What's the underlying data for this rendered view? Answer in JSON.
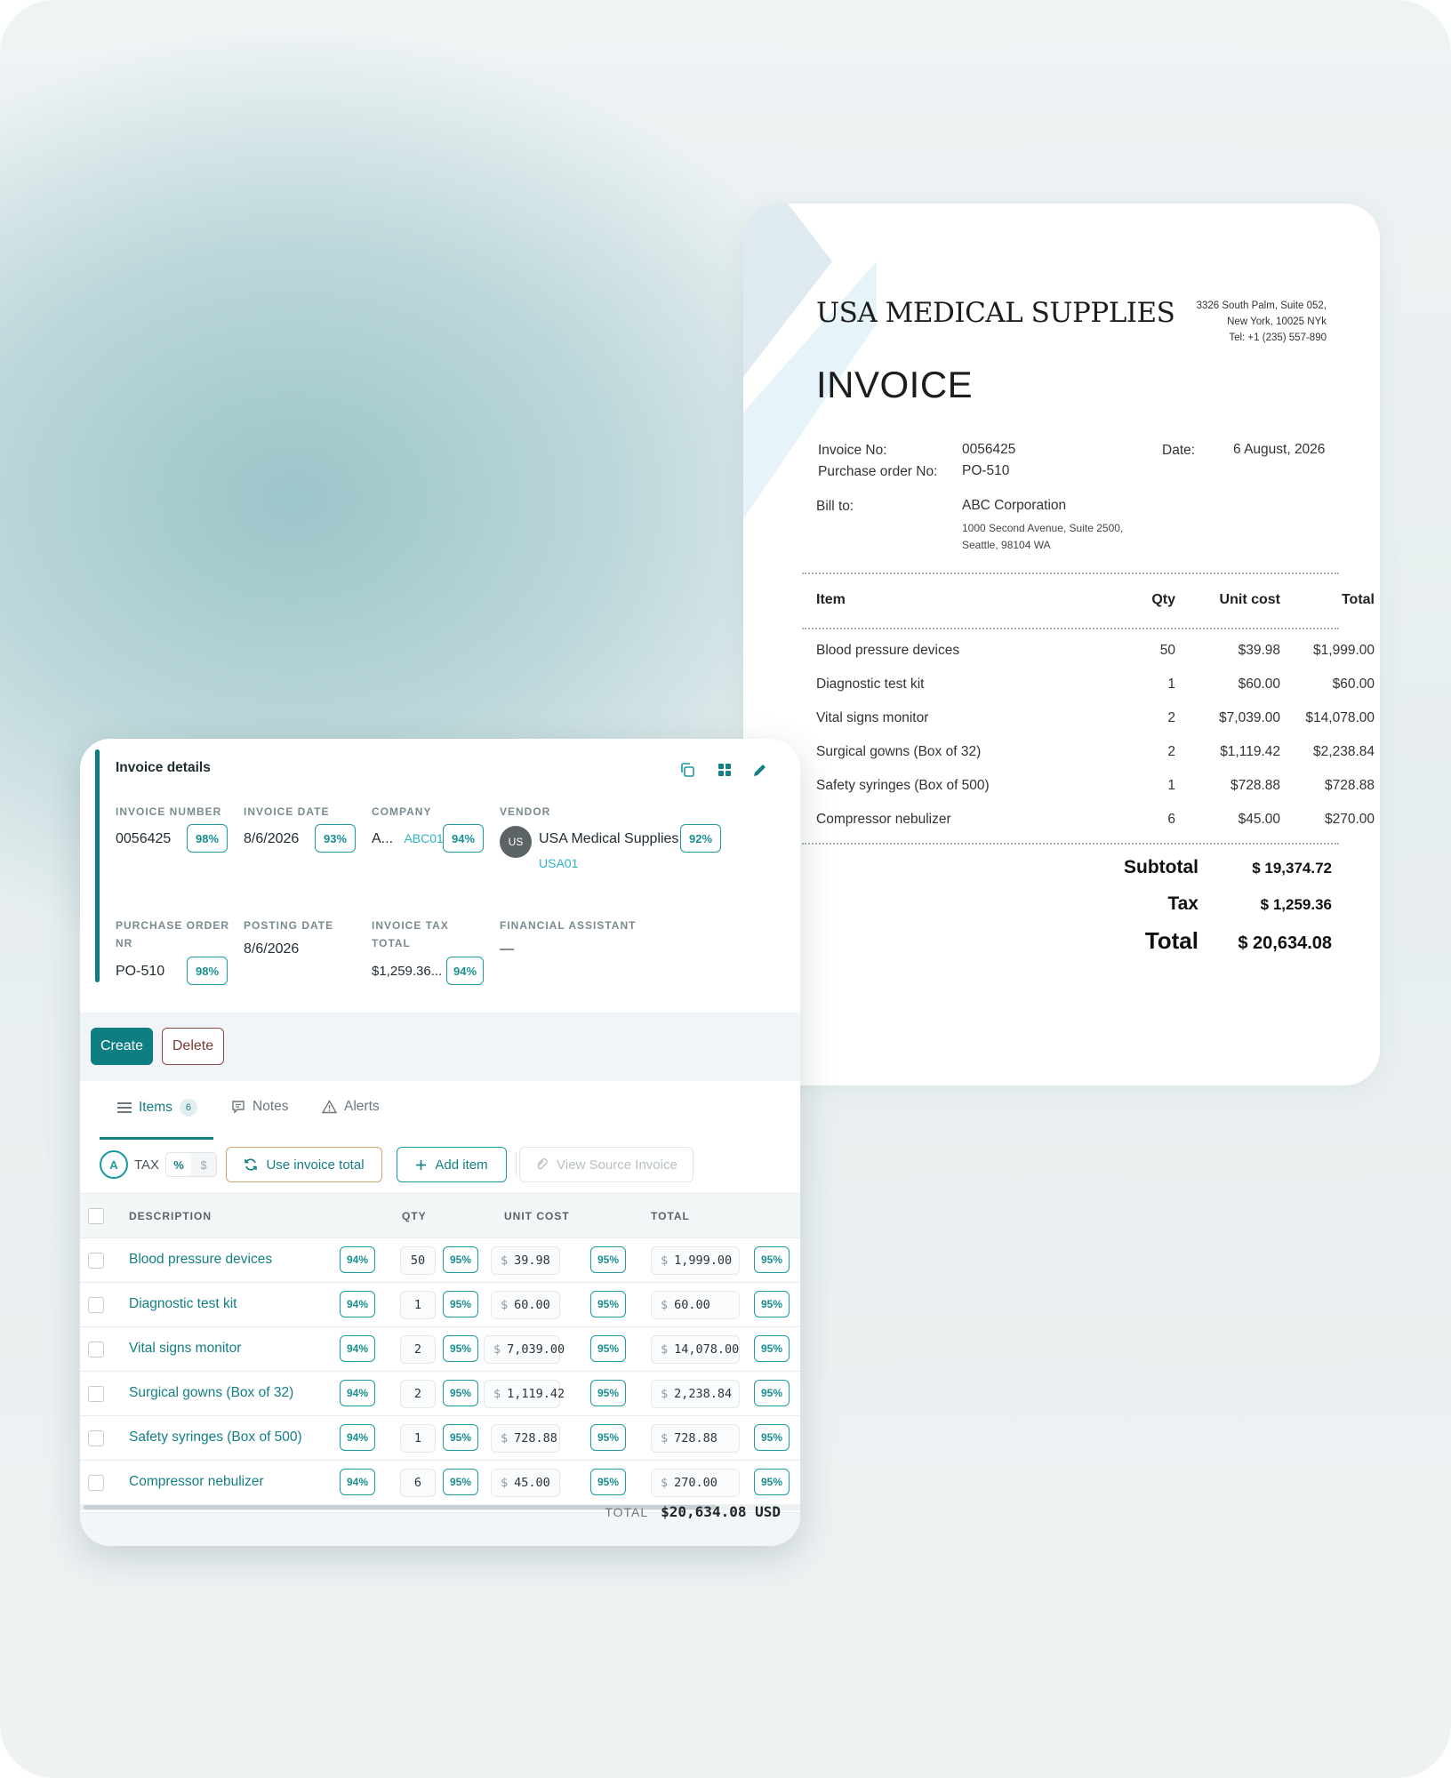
{
  "document": {
    "company": "USA MEDICAL SUPPLIES",
    "address": [
      "3326 South Palm, Suite 052,",
      "New York, 10025 NYk",
      "Tel: +1 (235) 557-890"
    ],
    "title": "INVOICE",
    "invoice_no_label": "Invoice No:",
    "invoice_no": "0056425",
    "po_label": "Purchase order No:",
    "po": "PO-510",
    "date_label": "Date:",
    "date": "6 August, 2026",
    "bill_to_label": "Bill to:",
    "bill_to_name": "ABC Corporation",
    "bill_to_address": [
      "1000 Second Avenue, Suite 2500,",
      "Seattle, 98104 WA"
    ],
    "headers": {
      "item": "Item",
      "qty": "Qty",
      "unit_cost": "Unit cost",
      "total": "Total"
    },
    "rows": [
      {
        "item": "Blood pressure devices",
        "qty": "50",
        "unit_cost": "$39.98",
        "total": "$1,999.00"
      },
      {
        "item": "Diagnostic test kit",
        "qty": "1",
        "unit_cost": "$60.00",
        "total": "$60.00"
      },
      {
        "item": "Vital signs monitor",
        "qty": "2",
        "unit_cost": "$7,039.00",
        "total": "$14,078.00"
      },
      {
        "item": "Surgical gowns (Box of 32)",
        "qty": "2",
        "unit_cost": "$1,119.42",
        "total": "$2,238.84"
      },
      {
        "item": "Safety syringes (Box of 500)",
        "qty": "1",
        "unit_cost": "$728.88",
        "total": "$728.88"
      },
      {
        "item": "Compressor nebulizer",
        "qty": "6",
        "unit_cost": "$45.00",
        "total": "$270.00"
      }
    ],
    "subtotal_label": "Subtotal",
    "subtotal": "$ 19,374.72",
    "tax_label": "Tax",
    "tax": "$ 1,259.36",
    "total_label": "Total",
    "total": "$ 20,634.08"
  },
  "panel": {
    "title": "Invoice details",
    "fields": {
      "invoice_number": {
        "label": "INVOICE NUMBER",
        "value": "0056425",
        "confidence": "98%"
      },
      "invoice_date": {
        "label": "INVOICE DATE",
        "value": "8/6/2026",
        "confidence": "93%"
      },
      "company": {
        "label": "COMPANY",
        "value": "A...",
        "code": "ABC01",
        "confidence": "94%"
      },
      "vendor": {
        "label": "VENDOR",
        "avatar": "US",
        "value": "USA Medical Supplies",
        "code": "USA01",
        "confidence": "92%"
      },
      "purchase_order": {
        "label_line1": "PURCHASE ORDER",
        "label_line2": "NR",
        "value": "PO-510",
        "confidence": "98%"
      },
      "posting_date": {
        "label": "POSTING DATE",
        "value": "8/6/2026"
      },
      "invoice_tax_total": {
        "label_line1": "INVOICE TAX",
        "label_line2": "TOTAL",
        "value": "$1,259.36...",
        "confidence": "94%"
      },
      "financial_assistant": {
        "label": "FINANCIAL ASSISTANT",
        "value": "—"
      }
    },
    "create_label": "Create",
    "delete_label": "Delete",
    "tabs": [
      {
        "label": "Items",
        "count": "6",
        "icon": "list-icon"
      },
      {
        "label": "Notes",
        "icon": "comment-icon"
      },
      {
        "label": "Alerts",
        "icon": "warning-icon"
      }
    ],
    "toolbar": {
      "auto_badge": "A",
      "tax_label": "TAX",
      "pct": "%",
      "dollar": "$",
      "use_invoice_total": "Use invoice total",
      "add_item": "Add item",
      "view_source": "View Source Invoice"
    },
    "grid_headers": {
      "description": "DESCRIPTION",
      "qty": "QTY",
      "unit_cost": "UNIT COST",
      "total": "TOTAL"
    },
    "currency_symbol": "$",
    "items": [
      {
        "description": "Blood pressure devices",
        "desc_conf": "94%",
        "qty": "50",
        "qty_conf": "95%",
        "unit_cost": "39.98",
        "unit_conf": "95%",
        "total": "1,999.00",
        "total_conf": "95%"
      },
      {
        "description": "Diagnostic test kit",
        "desc_conf": "94%",
        "qty": "1",
        "qty_conf": "95%",
        "unit_cost": "60.00",
        "unit_conf": "95%",
        "total": "60.00",
        "total_conf": "95%"
      },
      {
        "description": "Vital signs monitor",
        "desc_conf": "94%",
        "qty": "2",
        "qty_conf": "95%",
        "unit_cost": "7,039.00",
        "unit_conf": "95%",
        "total": "14,078.00",
        "total_conf": "95%"
      },
      {
        "description": "Surgical gowns (Box of 32)",
        "desc_conf": "94%",
        "qty": "2",
        "qty_conf": "95%",
        "unit_cost": "1,119.42",
        "unit_conf": "95%",
        "total": "2,238.84",
        "total_conf": "95%"
      },
      {
        "description": "Safety syringes (Box of 500)",
        "desc_conf": "94%",
        "qty": "1",
        "qty_conf": "95%",
        "unit_cost": "728.88",
        "unit_conf": "95%",
        "total": "728.88",
        "total_conf": "95%"
      },
      {
        "description": "Compressor nebulizer",
        "desc_conf": "94%",
        "qty": "6",
        "qty_conf": "95%",
        "unit_cost": "45.00",
        "unit_conf": "95%",
        "total": "270.00",
        "total_conf": "95%"
      }
    ],
    "footer_total_label": "TOTAL",
    "footer_total_value": "$20,634.08 USD"
  },
  "colors": {
    "accent": "#0f7e82",
    "confidence": "#1a9a9b",
    "link": "#137f84",
    "delete": "#8d4a3f"
  }
}
